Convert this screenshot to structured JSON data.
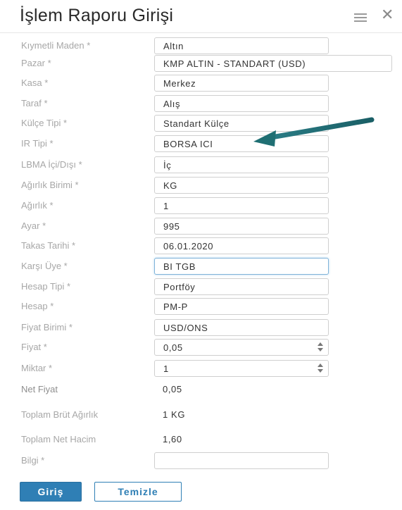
{
  "window": {
    "title": "İşlem Raporu Girişi"
  },
  "icons": {
    "menu": "hamburger-icon",
    "close": "close-icon",
    "close_glyph": "✕"
  },
  "form": {
    "kiymetli_maden": {
      "label": "Kıymetli Maden *",
      "value": "Altın"
    },
    "pazar": {
      "label": "Pazar *",
      "value": "KMP ALTIN - STANDART (USD)"
    },
    "kasa": {
      "label": "Kasa *",
      "value": "Merkez"
    },
    "taraf": {
      "label": "Taraf *",
      "value": "Alış"
    },
    "kulce_tipi": {
      "label": "Külçe Tipi *",
      "value": "Standart Külçe"
    },
    "ir_tipi": {
      "label": "IR Tipi *",
      "value": "BORSA ICI"
    },
    "lbma": {
      "label": "LBMA İçi/Dışı *",
      "value": "İç"
    },
    "agirlik_birimi": {
      "label": "Ağırlık Birimi *",
      "value": "KG"
    },
    "agirlik": {
      "label": "Ağırlık *",
      "value": "1"
    },
    "ayar": {
      "label": "Ayar *",
      "value": "995"
    },
    "takas_tarihi": {
      "label": "Takas Tarihi *",
      "value": "06.01.2020"
    },
    "karsi_uye": {
      "label": "Karşı Üye *",
      "value": "BI TGB"
    },
    "hesap_tipi": {
      "label": "Hesap Tipi *",
      "value": "Portföy"
    },
    "hesap": {
      "label": "Hesap *",
      "value": "PM-P"
    },
    "fiyat_birimi": {
      "label": "Fiyat Birimi *",
      "value": "USD/ONS"
    },
    "fiyat": {
      "label": "Fiyat *",
      "value": "0,05"
    },
    "miktar": {
      "label": "Miktar *",
      "value": "1"
    },
    "net_fiyat": {
      "label": "Net Fiyat",
      "value": "0,05"
    },
    "toplam_brut_agirlik": {
      "label": "Toplam Brüt Ağırlık",
      "value": "1 KG"
    },
    "toplam_net_hacim": {
      "label": "Toplam Net Hacim",
      "value": "1,60"
    },
    "bilgi": {
      "label": "Bilgi *",
      "value": ""
    }
  },
  "buttons": {
    "submit": "Giriş",
    "clear": "Temizle"
  },
  "colors": {
    "accent": "#2f7fb5",
    "arrow": "#1f6f73"
  }
}
